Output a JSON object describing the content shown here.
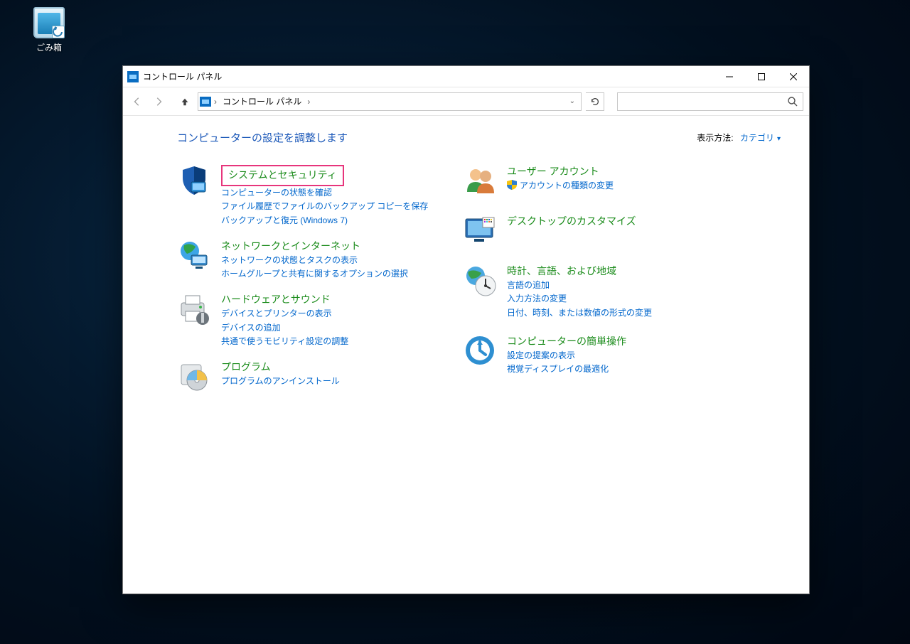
{
  "desktop": {
    "recycle_bin_label": "ごみ箱"
  },
  "window": {
    "title": "コントロール パネル",
    "address": {
      "root_label": "コントロール パネル"
    },
    "search_placeholder": ""
  },
  "header": {
    "adjust_label": "コンピューターの設定を調整します",
    "view_by_label": "表示方法:",
    "view_by_value": "カテゴリ"
  },
  "left_categories": [
    {
      "id": "system-security",
      "title": "システムとセキュリティ",
      "highlight": true,
      "links": [
        {
          "text": "コンピューターの状態を確認"
        },
        {
          "text": "ファイル履歴でファイルのバックアップ コピーを保存"
        },
        {
          "text": "バックアップと復元 (Windows 7)"
        }
      ]
    },
    {
      "id": "network-internet",
      "title": "ネットワークとインターネット",
      "links": [
        {
          "text": "ネットワークの状態とタスクの表示"
        },
        {
          "text": "ホームグループと共有に関するオプションの選択"
        }
      ]
    },
    {
      "id": "hardware-sound",
      "title": "ハードウェアとサウンド",
      "links": [
        {
          "text": "デバイスとプリンターの表示"
        },
        {
          "text": "デバイスの追加"
        },
        {
          "text": "共通で使うモビリティ設定の調整"
        }
      ]
    },
    {
      "id": "programs",
      "title": "プログラム",
      "links": [
        {
          "text": "プログラムのアンインストール"
        }
      ]
    }
  ],
  "right_categories": [
    {
      "id": "user-accounts",
      "title": "ユーザー アカウント",
      "links": [
        {
          "text": "アカウントの種類の変更",
          "shield": true
        }
      ]
    },
    {
      "id": "appearance",
      "title": "デスクトップのカスタマイズ",
      "links": []
    },
    {
      "id": "clock-language-region",
      "title": "時計、言語、および地域",
      "links": [
        {
          "text": "言語の追加"
        },
        {
          "text": "入力方法の変更"
        },
        {
          "text": "日付、時刻、または数値の形式の変更"
        }
      ]
    },
    {
      "id": "ease-of-access",
      "title": "コンピューターの簡単操作",
      "links": [
        {
          "text": "設定の提案の表示"
        },
        {
          "text": "視覚ディスプレイの最適化"
        }
      ]
    }
  ]
}
